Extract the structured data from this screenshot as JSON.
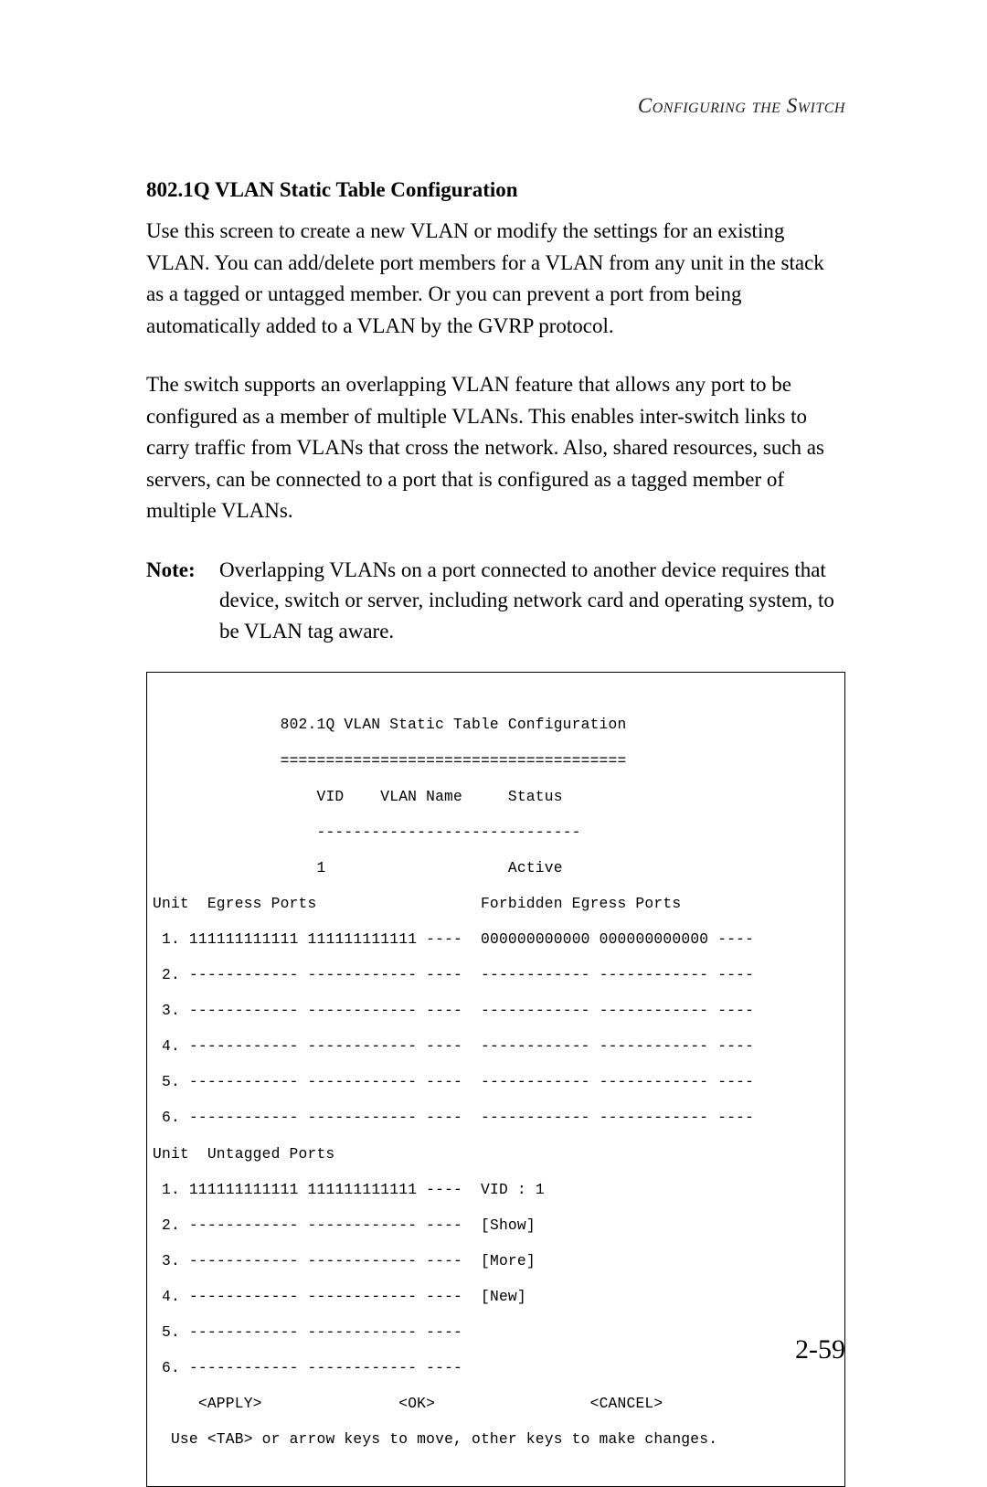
{
  "header": {
    "running_title": "Configuring the Switch"
  },
  "section": {
    "heading": "802.1Q VLAN Static Table Configuration",
    "paragraph1": "Use this screen to create a new VLAN or modify the settings for an existing VLAN. You can add/delete port members for a VLAN from any unit in the stack as a tagged or untagged member. Or you can  prevent a port from being automatically added to a VLAN by the GVRP protocol.",
    "paragraph2": "The switch supports an overlapping VLAN feature that allows any port to be configured as a member of multiple VLANs. This enables inter-switch links to carry traffic from VLANs that cross the network. Also, shared resources, such as servers, can be connected to a port that is configured as a tagged member of multiple VLANs.",
    "note_label": "Note:",
    "note_body": "Overlapping VLANs on a port connected to another device requires that device, switch or server, including network card and operating system, to be VLAN tag aware."
  },
  "terminal": {
    "title": "802.1Q VLAN Static Table Configuration",
    "title_divider": "======================================",
    "col_header": "VID    VLAN Name     Status",
    "col_divider": "-----------------------------",
    "row1_vid": "1",
    "row1_status": "Active",
    "group1_header_left": "Unit  Egress Ports",
    "group1_header_right": "Forbidden Egress Ports",
    "egress_rows": [
      {
        "n": "1",
        "left": "111111111111 111111111111 ----",
        "right": "000000000000 000000000000 ----"
      },
      {
        "n": "2",
        "left": "------------ ------------ ----",
        "right": "------------ ------------ ----"
      },
      {
        "n": "3",
        "left": "------------ ------------ ----",
        "right": "------------ ------------ ----"
      },
      {
        "n": "4",
        "left": "------------ ------------ ----",
        "right": "------------ ------------ ----"
      },
      {
        "n": "5",
        "left": "------------ ------------ ----",
        "right": "------------ ------------ ----"
      },
      {
        "n": "6",
        "left": "------------ ------------ ----",
        "right": "------------ ------------ ----"
      }
    ],
    "group2_header": "Unit  Untagged Ports",
    "untagged_rows": [
      {
        "n": "1",
        "left": "111111111111 111111111111 ----",
        "right": "VID : 1"
      },
      {
        "n": "2",
        "left": "------------ ------------ ----",
        "right": "[Show]"
      },
      {
        "n": "3",
        "left": "------------ ------------ ----",
        "right": "[More]"
      },
      {
        "n": "4",
        "left": "------------ ------------ ----",
        "right": "[New]"
      },
      {
        "n": "5",
        "left": "------------ ------------ ----",
        "right": ""
      },
      {
        "n": "6",
        "left": "------------ ------------ ----",
        "right": ""
      }
    ],
    "btn_apply": "<APPLY>",
    "btn_ok": "<OK>",
    "btn_cancel": "<CANCEL>",
    "hint": "Use <TAB> or arrow keys to move, other keys to make changes."
  },
  "footer": {
    "page_number": "2-59"
  }
}
